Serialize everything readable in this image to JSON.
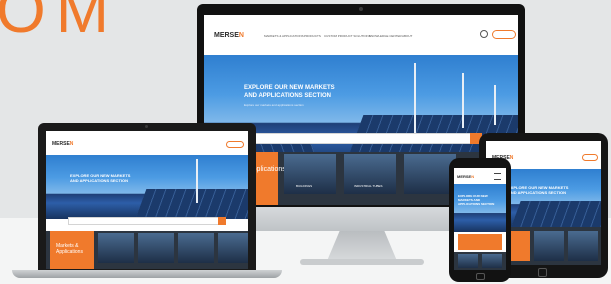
{
  "brand_word": "OM",
  "colors": {
    "accent": "#f07a2c",
    "sky": "#3b8ee0",
    "panel": "#1b3a6b",
    "frame": "#111111"
  },
  "monitor_site": {
    "logo_prefix": "MERSE",
    "logo_accent": "N",
    "nav": [
      "MARKETS & APPLICATIONS",
      "PRODUCTS",
      "CUSTOM PRODUCT SOLUTIONS",
      "KNOWLEDGE CENTER",
      "ABOUT"
    ],
    "hero_title_1": "EXPLORE OUR NEW MARKETS",
    "hero_title_2": "AND APPLICATIONS SECTION",
    "hero_sub": "Explore our markets and applications section"
  },
  "laptop_site": {
    "logo_prefix": "MERSE",
    "logo_accent": "N",
    "hero_title_1": "EXPLORE OUR NEW MARKETS",
    "hero_title_2": "AND APPLICATIONS SECTION",
    "feature_title_1": "Markets &",
    "feature_title_2": "Applications"
  },
  "monitor_strip": {
    "label": "Applications",
    "tile_1": "BUILDINGS",
    "tile_2": "INDUSTRIAL TUBES"
  },
  "tablet_site": {
    "logo_prefix": "MERSE",
    "logo_accent": "N",
    "hero_title_1": "EXPLORE OUR NEW MARKETS",
    "hero_title_2": "AND APPLICATIONS SECTION"
  },
  "phone_site": {
    "logo_prefix": "MERSE",
    "logo_accent": "N",
    "hero_title_1": "EXPLORE OUR NEW",
    "hero_title_2": "MARKETS AND",
    "hero_title_3": "APPLICATIONS SECTION"
  }
}
